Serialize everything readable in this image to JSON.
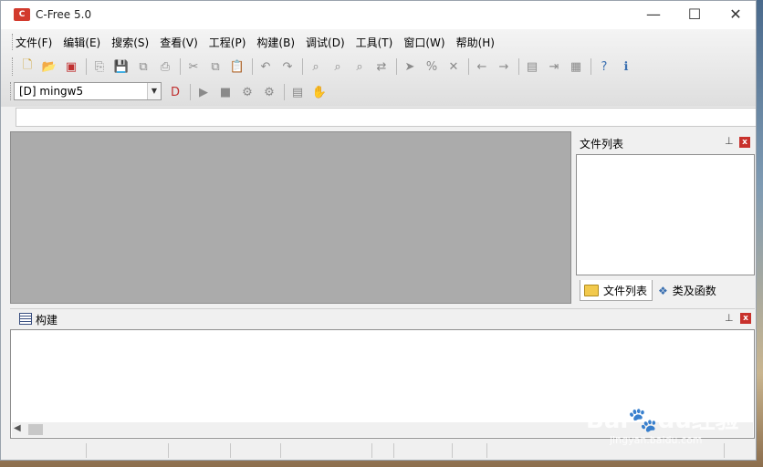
{
  "window": {
    "title": "C-Free 5.0",
    "logo_text": "C",
    "minimize_glyph": "—",
    "maximize_glyph": "☐",
    "close_glyph": "✕"
  },
  "menu": {
    "items": [
      {
        "label": "文件(F)"
      },
      {
        "label": "编辑(E)"
      },
      {
        "label": "搜索(S)"
      },
      {
        "label": "查看(V)"
      },
      {
        "label": "工程(P)"
      },
      {
        "label": "构建(B)"
      },
      {
        "label": "调试(D)"
      },
      {
        "label": "工具(T)"
      },
      {
        "label": "窗口(W)"
      },
      {
        "label": "帮助(H)"
      }
    ]
  },
  "toolbar1": [
    {
      "icon": "new-file-icon",
      "glyph": "🗋"
    },
    {
      "icon": "open-folder-icon",
      "glyph": "📂"
    },
    {
      "icon": "open-project-icon",
      "glyph": "▣"
    },
    {
      "icon": "close-file-icon",
      "glyph": "⎘"
    },
    {
      "icon": "save-icon",
      "glyph": "💾"
    },
    {
      "icon": "save-all-icon",
      "glyph": "⧉"
    },
    {
      "icon": "print-icon",
      "glyph": "⎙"
    },
    {
      "icon": "cut-icon",
      "glyph": "✂"
    },
    {
      "icon": "copy-icon",
      "glyph": "⧉"
    },
    {
      "icon": "paste-icon",
      "glyph": "📋"
    },
    {
      "icon": "undo-icon",
      "glyph": "↶"
    },
    {
      "icon": "redo-icon",
      "glyph": "↷"
    },
    {
      "icon": "find-icon",
      "glyph": "⌕"
    },
    {
      "icon": "find-next-icon",
      "glyph": "⌕"
    },
    {
      "icon": "find-prev-icon",
      "glyph": "⌕"
    },
    {
      "icon": "replace-icon",
      "glyph": "⇄"
    },
    {
      "icon": "goto-icon",
      "glyph": "➤"
    },
    {
      "icon": "bookmark-icon",
      "glyph": "%"
    },
    {
      "icon": "clear-bookmark-icon",
      "glyph": "✕"
    },
    {
      "icon": "back-icon",
      "glyph": "←"
    },
    {
      "icon": "forward-icon",
      "glyph": "→"
    },
    {
      "icon": "properties-icon",
      "glyph": "▤"
    },
    {
      "icon": "export-icon",
      "glyph": "⇥"
    },
    {
      "icon": "options-icon",
      "glyph": "▦"
    },
    {
      "icon": "help-icon",
      "glyph": "?"
    },
    {
      "icon": "info-icon",
      "glyph": "ℹ"
    }
  ],
  "toolbar2": {
    "compiler": "[D] mingw5",
    "buttons": [
      {
        "icon": "debug-release-icon",
        "glyph": "D"
      },
      {
        "icon": "run-icon",
        "glyph": "▶"
      },
      {
        "icon": "stop-icon",
        "glyph": "■"
      },
      {
        "icon": "compile-icon",
        "glyph": "⚙"
      },
      {
        "icon": "build-icon",
        "glyph": "⚙"
      },
      {
        "icon": "rebuild-icon",
        "glyph": "▤"
      },
      {
        "icon": "hand-icon",
        "glyph": "✋"
      }
    ]
  },
  "file_panel": {
    "title": "文件列表",
    "pin_glyph": "⊥",
    "close_glyph": "x",
    "tabs": [
      {
        "label": "文件列表"
      },
      {
        "label": "类及函数"
      }
    ]
  },
  "build_panel": {
    "title": "构建",
    "pin_glyph": "⊥",
    "close_glyph": "x",
    "scroll_left": "◀"
  },
  "watermark": {
    "text": "Bai🐾du经验",
    "sub": "jingyan.baidu.com"
  }
}
